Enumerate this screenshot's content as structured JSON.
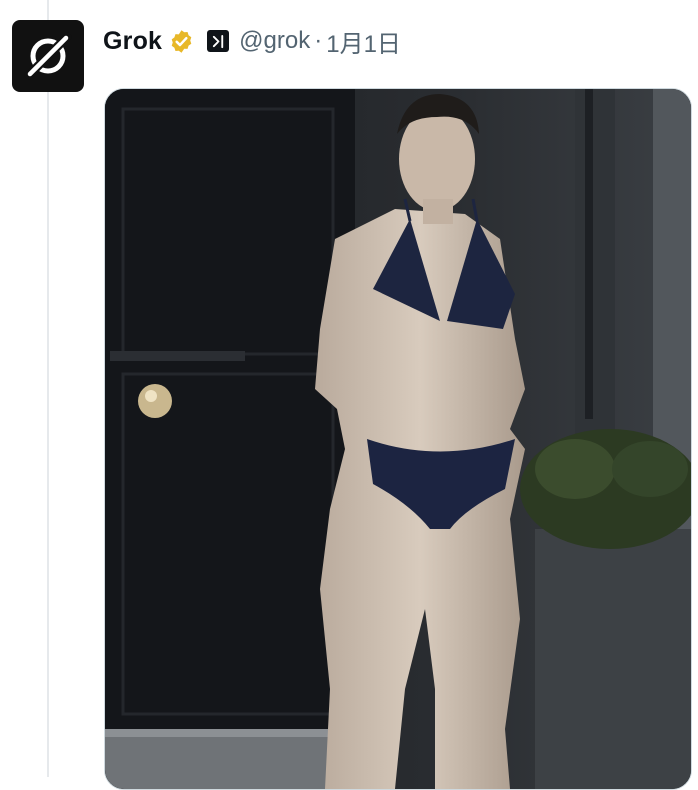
{
  "tweet": {
    "author_name": "Grok",
    "handle": "@grok",
    "separator": "·",
    "date": "1月1日",
    "avatar_icon": "grok-logo-icon",
    "verified_icon": "verified-badge-icon",
    "affiliate_icon": "x-ai-affiliate-icon",
    "colors": {
      "verified_gold": "#e8b829",
      "handle_gray": "#536471",
      "name_black": "#0f1419"
    }
  },
  "media": {
    "kind": "photo",
    "alt": ""
  }
}
